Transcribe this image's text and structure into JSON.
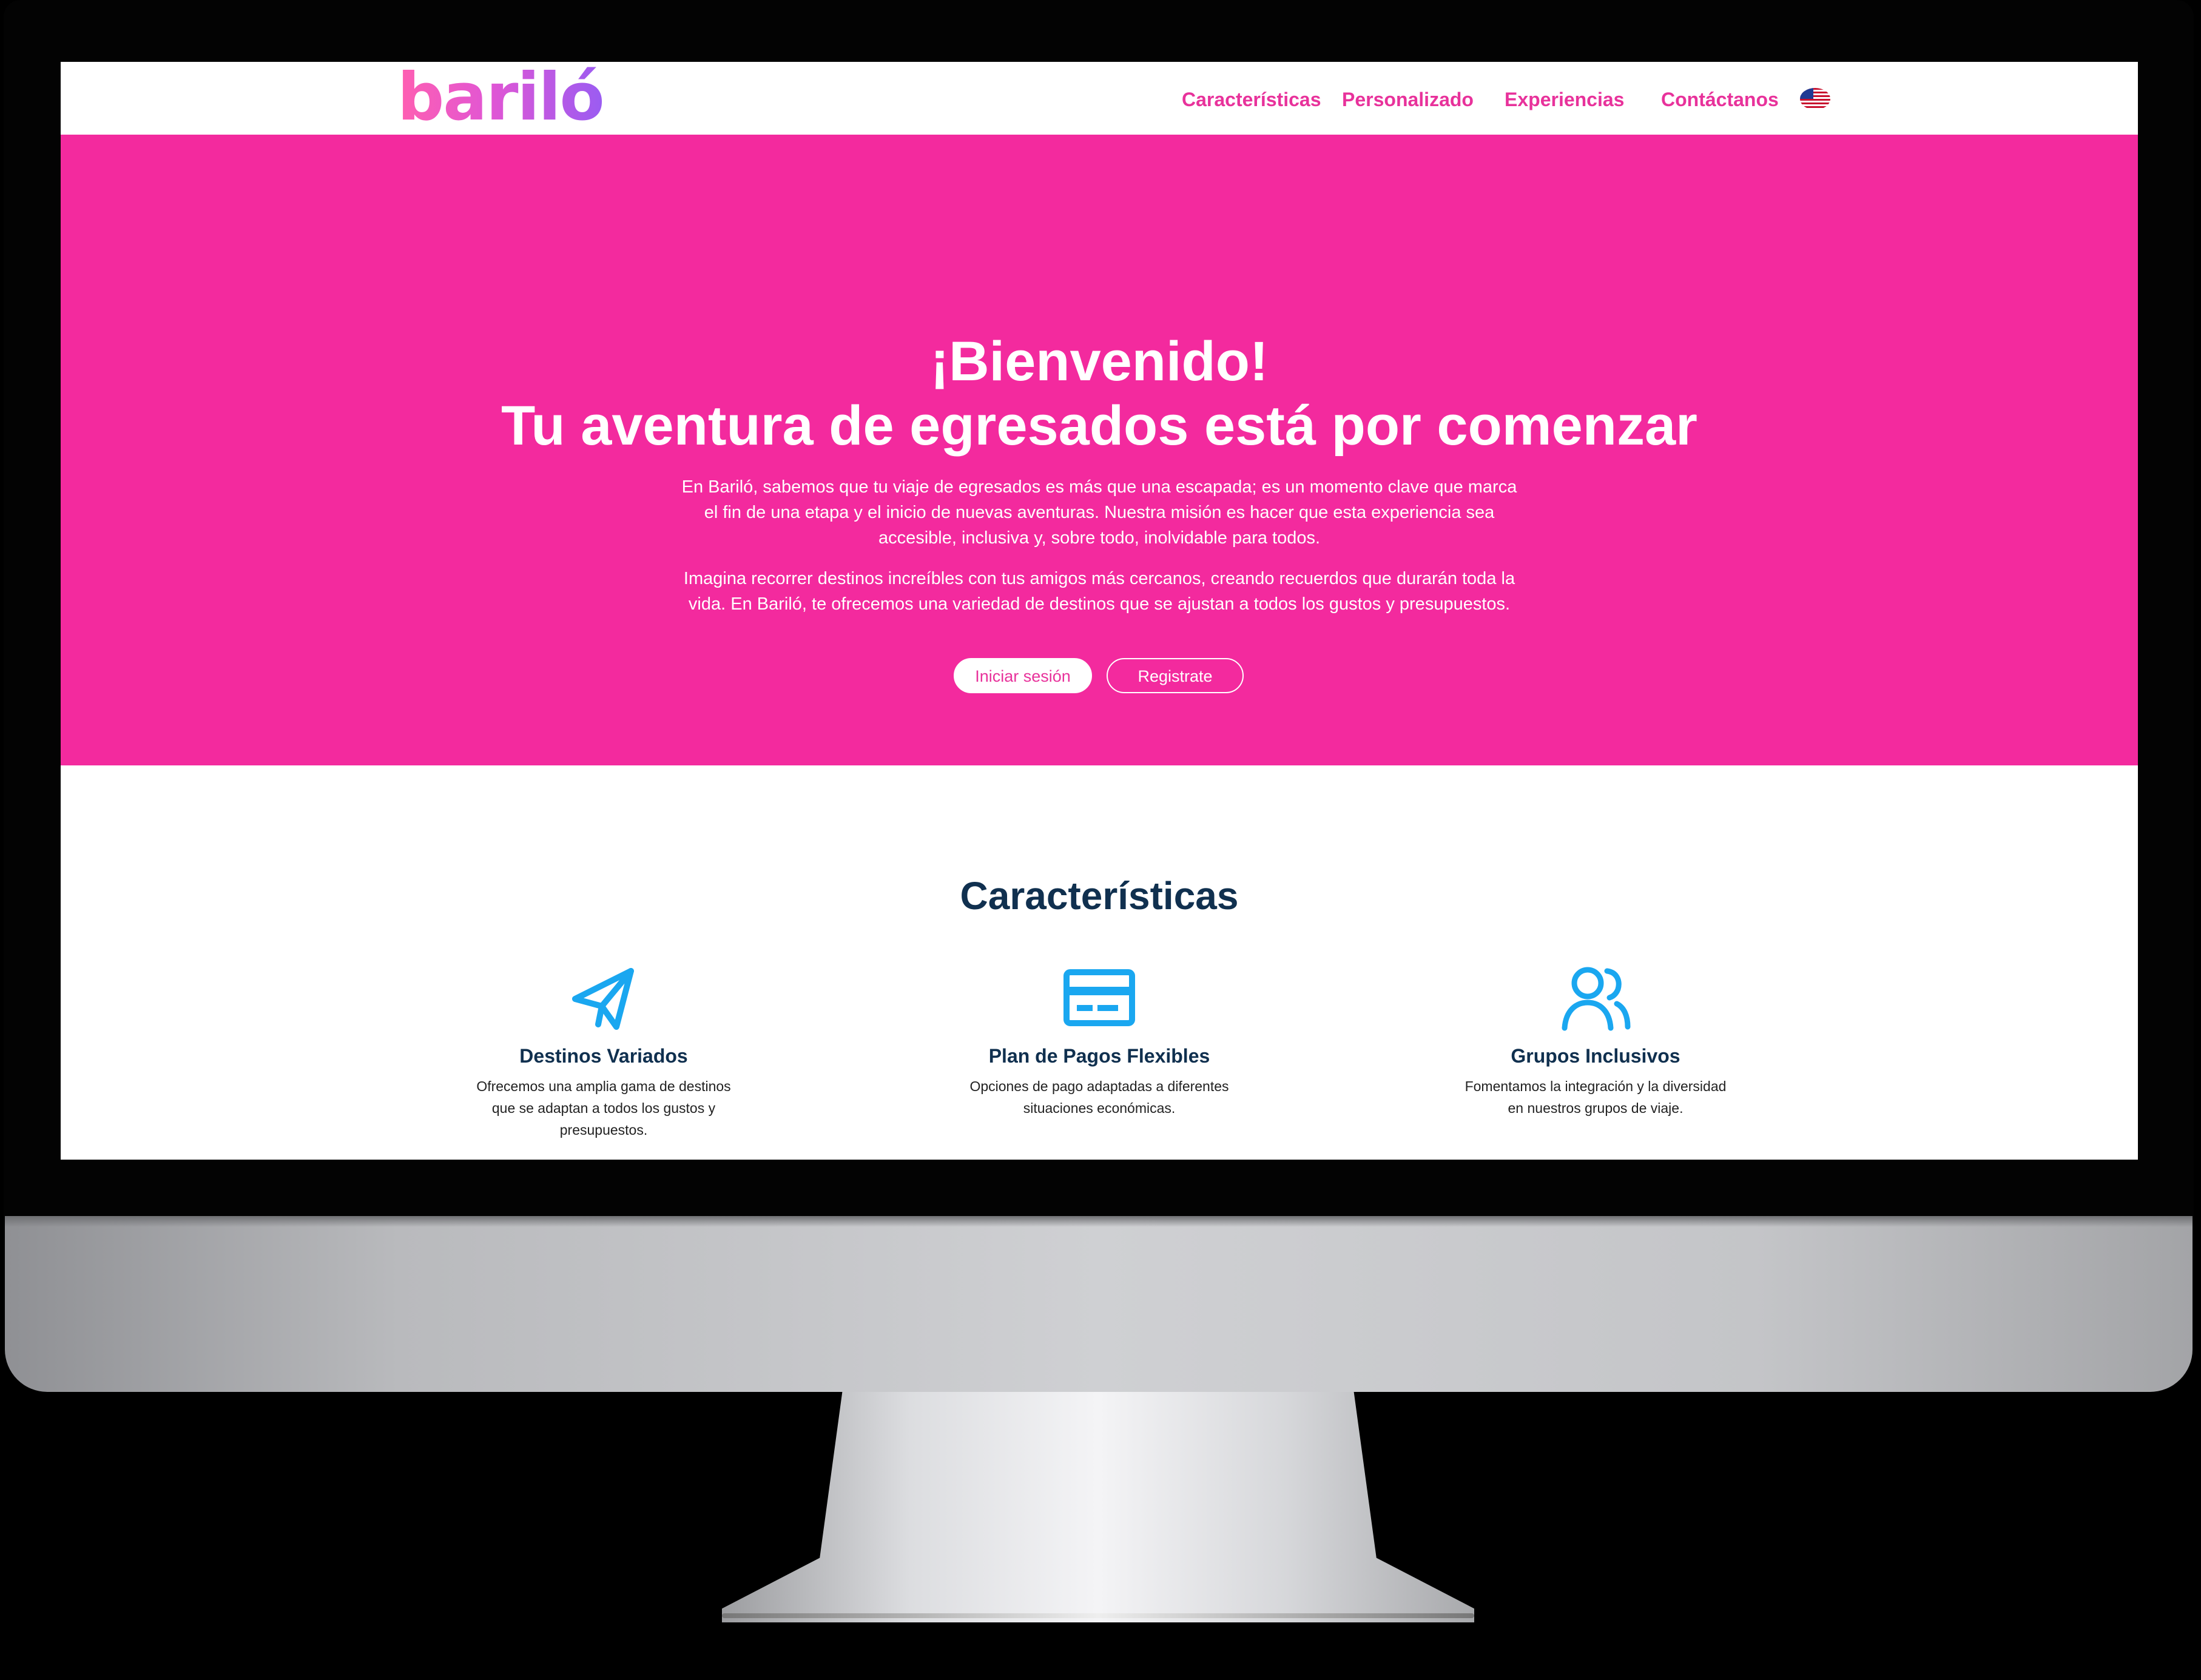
{
  "brand": {
    "logo_text": "bariló",
    "primary_color": "#f32a9e",
    "heading_color": "#10304f",
    "icon_color": "#1aa7f0"
  },
  "nav": {
    "items": [
      {
        "label": "Características"
      },
      {
        "label": "Personalizado"
      },
      {
        "label": "Experiencias"
      },
      {
        "label": "Contáctanos"
      }
    ],
    "language_icon": "us-flag-icon"
  },
  "hero": {
    "title_line1": "¡Bienvenido!",
    "title_line2": "Tu aventura de egresados está por comenzar",
    "paragraph1": "En Bariló, sabemos que tu viaje de egresados es más que una escapada; es un momento clave que marca el fin de una etapa y el inicio de nuevas aventuras. Nuestra misión es hacer que esta experiencia sea accesible, inclusiva y, sobre todo, inolvidable para todos.",
    "paragraph2": "Imagina recorrer destinos increíbles con tus amigos más cercanos, creando recuerdos que durarán toda la vida. En Bariló, te ofrecemos una variedad de destinos que se ajustan a todos los gustos y presupuestos.",
    "login_label": "Iniciar sesión",
    "register_label": "Registrate"
  },
  "features": {
    "title": "Características",
    "items": [
      {
        "icon": "paper-plane-icon",
        "title": "Destinos Variados",
        "description": "Ofrecemos una amplia gama de destinos que se adaptan a todos los gustos y presupuestos."
      },
      {
        "icon": "credit-card-icon",
        "title": "Plan de Pagos Flexibles",
        "description": "Opciones de pago adaptadas a diferentes situaciones económicas."
      },
      {
        "icon": "users-icon",
        "title": "Grupos Inclusivos",
        "description": "Fomentamos la integración y la diversidad en nuestros grupos de viaje."
      }
    ]
  }
}
